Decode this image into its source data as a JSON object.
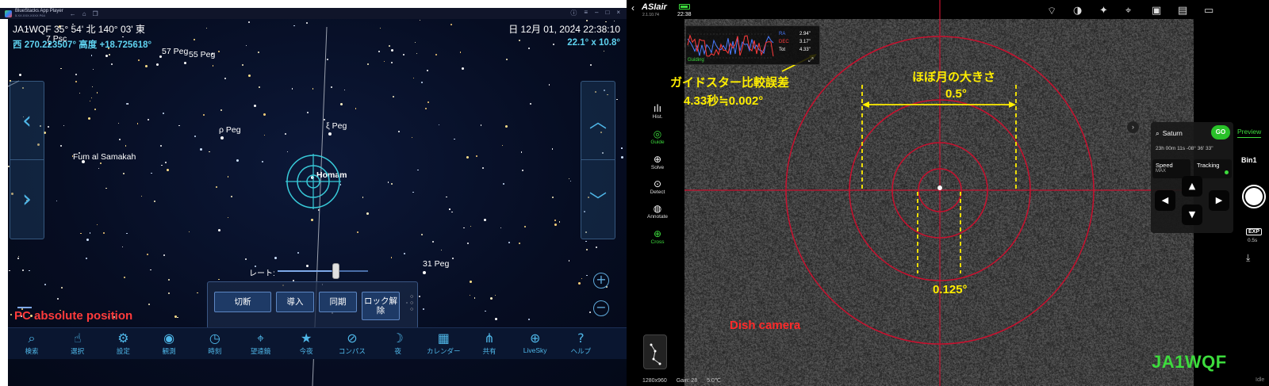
{
  "left": {
    "window": {
      "title": "BlueStacks App Player",
      "subtitle": "5.XX.XXX.XXXX P64"
    },
    "sky": {
      "location": "JA1WQF  35° 54' 北  140° 03' 東",
      "datetime": "日 12月 01, 2024  22:38:10",
      "azalt": "西  270.223507° 高度 +18.725618°",
      "fov": "22.1° x 10.8°",
      "star_labels": [
        {
          "id": "7psc",
          "text": "7 Psc"
        },
        {
          "id": "57peg",
          "text": "57 Peg"
        },
        {
          "id": "55peg",
          "text": "55 Peg"
        },
        {
          "id": "rhopeg",
          "text": "ρ Peg"
        },
        {
          "id": "xipeg",
          "text": "ξ Peg"
        },
        {
          "id": "fum",
          "text": "Fum al Samakah"
        },
        {
          "id": "homam",
          "text": "Homam"
        },
        {
          "id": "31peg",
          "text": "31 Peg"
        }
      ],
      "rate_label": "レート:",
      "rate_level": 0.6,
      "scope_buttons": [
        "切断",
        "導入",
        "同期",
        "ロック解\n除"
      ],
      "zoom_in": "+",
      "zoom_out": "−",
      "overlay_label": "PC absolute position",
      "toolbar": [
        {
          "icon": "search-icon",
          "glyph": "⌕",
          "label": "検索"
        },
        {
          "icon": "select-icon",
          "glyph": "☝",
          "label": "選択"
        },
        {
          "icon": "settings-icon",
          "glyph": "⚙",
          "label": "設定"
        },
        {
          "icon": "eye-icon",
          "glyph": "◉",
          "label": "観測"
        },
        {
          "icon": "clock-icon",
          "glyph": "◷",
          "label": "時刻"
        },
        {
          "icon": "telescope-icon",
          "glyph": "⌖",
          "label": "望遠鏡"
        },
        {
          "icon": "tonight-icon",
          "glyph": "★",
          "label": "今夜"
        },
        {
          "icon": "compass-icon",
          "glyph": "⊘",
          "label": "コンパス"
        },
        {
          "icon": "night-icon",
          "glyph": "☽",
          "label": "夜"
        },
        {
          "icon": "calendar-icon",
          "glyph": "▦",
          "label": "カレンダー"
        },
        {
          "icon": "share-icon",
          "glyph": "⋔",
          "label": "共有"
        },
        {
          "icon": "livesky-icon",
          "glyph": "⊕",
          "label": "LiveSky"
        },
        {
          "icon": "help-icon",
          "glyph": "?",
          "label": "ヘルプ"
        }
      ]
    }
  },
  "right": {
    "topbar": {
      "logo": "ASIair",
      "version": "2.1.10.74",
      "time": "22:38",
      "icons": [
        "wifi-icon",
        "gauge-icon",
        "mount-icon",
        "telescope-icon",
        "camera-icon",
        "guide-cam-icon",
        "usb-icon"
      ]
    },
    "guide_graph": {
      "ra_label": "RA",
      "ra_value": "2.94\"",
      "dec_label": "DEC",
      "dec_value": "3.17\"",
      "tot_label": "Tot",
      "tot_value": "4.33\"",
      "status": "Guiding"
    },
    "left_tools": [
      {
        "icon": "histogram-icon",
        "glyph": "ılı",
        "label": "Hist.",
        "active": false
      },
      {
        "icon": "guide-icon",
        "glyph": "◎",
        "label": "Guide",
        "active": true
      },
      {
        "icon": "solve-icon",
        "glyph": "⊕",
        "label": "Solve",
        "active": false
      },
      {
        "icon": "detect-icon",
        "glyph": "⊙",
        "label": "Detect",
        "active": false
      },
      {
        "icon": "annotate-icon",
        "glyph": "◍",
        "label": "Annotate",
        "active": false
      },
      {
        "icon": "cross-icon",
        "glyph": "⊕",
        "label": "Cross",
        "active": true
      }
    ],
    "annotations": {
      "guide_err_title": "ガイドスター比較誤差",
      "guide_err_value": "4.33秒≒0.002°",
      "moon_title": "ほぼ月の大きさ",
      "moon_value": "0.5°",
      "inner_value": "0.125°",
      "dish_label": "Dish camera",
      "signature": "JA1WQF"
    },
    "bottom_info": {
      "resolution": "1280x960",
      "gain": "Gain: 28",
      "temp": "5.0℃"
    },
    "target": {
      "name": "Saturn",
      "go": "GO",
      "info": "23h 00m 11s  -08° 36' 33\"",
      "speed_label": "Speed",
      "speed_value": "MAX",
      "tracking_label": "Tracking",
      "tracking_on": true
    },
    "camera_panel": {
      "preview": "Preview",
      "bin": "Bin1",
      "exp_label": "EXP",
      "exp_value": "0.5s",
      "status": "Idle"
    }
  }
}
